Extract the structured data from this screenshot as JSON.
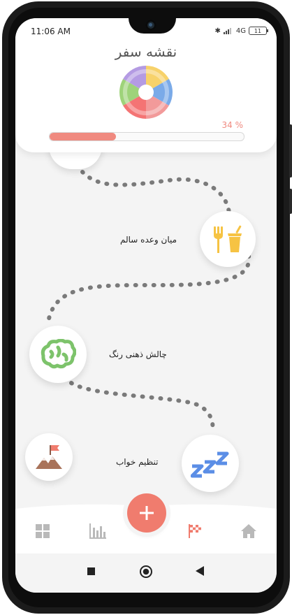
{
  "status_bar": {
    "time": "11:06 AM",
    "network": "4G",
    "battery": "11"
  },
  "header": {
    "title": "نقشه سفر",
    "progress_text": "34 %",
    "progress_value": 0.34
  },
  "journey": {
    "steps": [
      {
        "label": "میان وعده سالم",
        "icon": "fork-and-drink-icon"
      },
      {
        "label": "چالش ذهنی رنگ",
        "icon": "brain-icon"
      },
      {
        "label": "تنظیم خواب",
        "icon": "sleep-zzz-icon"
      },
      {
        "label": "",
        "icon": "mountain-flag-icon"
      }
    ]
  },
  "bottom_nav": {
    "items": [
      {
        "name": "dashboard",
        "icon": "grid-icon",
        "active": false
      },
      {
        "name": "stats",
        "icon": "bar-chart-icon",
        "active": false
      },
      {
        "name": "journey",
        "icon": "checkered-flag-icon",
        "active": true
      },
      {
        "name": "home",
        "icon": "home-icon",
        "active": false
      }
    ],
    "fab_icon": "plus-icon"
  },
  "colors": {
    "accent": "#f07c6e",
    "inactive_icon": "#b9b9b9",
    "food_icon": "#f6c343",
    "brain_icon": "#7dc36b",
    "sleep_icon": "#5b8ee6",
    "mountain_icon": "#a9735a"
  },
  "system_nav": [
    "square-recents-icon",
    "circle-home-icon",
    "triangle-back-icon"
  ]
}
